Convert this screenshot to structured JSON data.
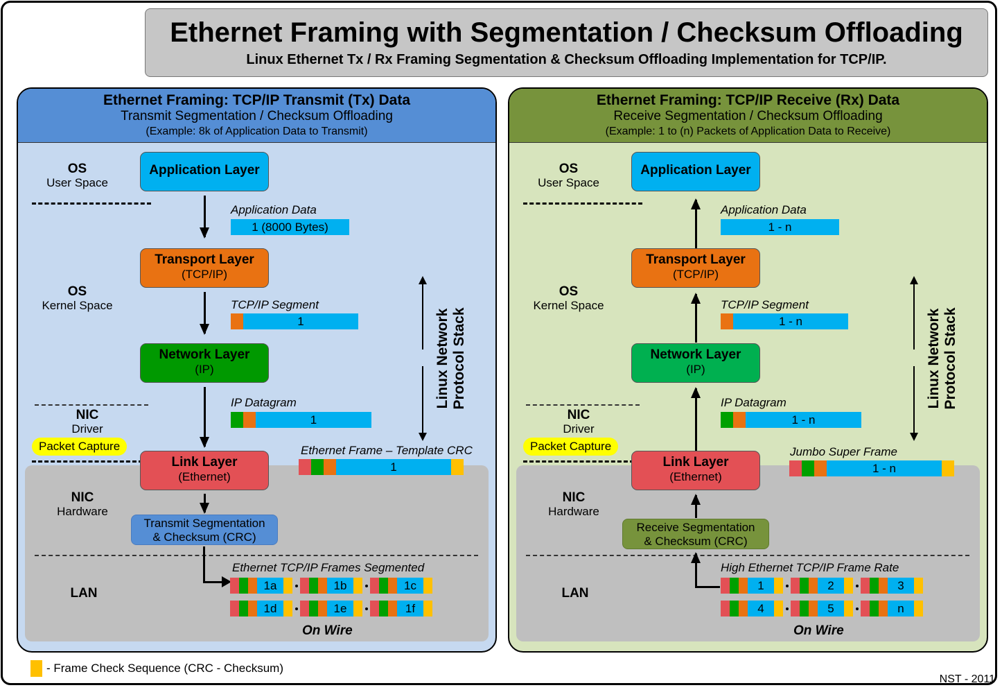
{
  "title": "Ethernet Framing with Segmentation / Checksum Offloading",
  "subtitle": "Linux Ethernet Tx / Rx Framing Segmentation & Checksum Offloading Implementation for TCP/IP.",
  "colors": {
    "tx_header": "#558ed5",
    "tx_body": "#c6d9f0",
    "rx_header": "#77933c",
    "rx_body": "#d7e4bd",
    "nic_area": "#bfbfbf",
    "application": "#00b0f0",
    "transport": "#e97212",
    "network_tx": "#009900",
    "network_rx": "#00b050",
    "link": "#e35055",
    "crc": "#ffc000",
    "capture": "#ffff00"
  },
  "tx": {
    "header": {
      "title": "Ethernet Framing: TCP/IP Transmit (Tx) Data",
      "subtitle": "Transmit Segmentation / Checksum Offloading",
      "example": "(Example: 8k of Application Data to Transmit)"
    },
    "side": {
      "os_user": {
        "title": "OS",
        "sub": "User Space"
      },
      "os_kernel": {
        "title": "OS",
        "sub": "Kernel Space"
      },
      "nic_driver": {
        "title": "NIC",
        "sub": "Driver"
      },
      "nic_hw": {
        "title": "NIC",
        "sub": "Hardware"
      },
      "lan": "LAN"
    },
    "packet_capture": "Packet Capture",
    "layers": {
      "application": {
        "name": "Application Layer"
      },
      "transport": {
        "name": "Transport Layer",
        "sub": "(TCP/IP)"
      },
      "network": {
        "name": "Network Layer",
        "sub": "(IP)"
      },
      "link": {
        "name": "Link Layer",
        "sub": "(Ethernet)"
      }
    },
    "hw_box": {
      "line1": "Transmit Segmentation",
      "line2": "& Checksum (CRC)"
    },
    "packets": {
      "app_data": {
        "label": "Application Data",
        "value": "1 (8000 Bytes)"
      },
      "segment": {
        "label": "TCP/IP Segment",
        "value": "1"
      },
      "datagram": {
        "label": "IP Datagram",
        "value": "1"
      },
      "frame": {
        "label": "Ethernet Frame – Template CRC",
        "value": "1"
      },
      "wire": {
        "label": "Ethernet TCP/IP Frames Segmented",
        "frames": [
          "1a",
          "1b",
          "1c",
          "1d",
          "1e",
          "1f"
        ]
      }
    },
    "stack_label": {
      "line1": "Linux Network",
      "line2": "Protocol Stack"
    },
    "on_wire": "On Wire"
  },
  "rx": {
    "header": {
      "title": "Ethernet Framing: TCP/IP Receive (Rx) Data",
      "subtitle": "Receive Segmentation / Checksum Offloading",
      "example": "(Example: 1 to (n) Packets of Application Data to Receive)"
    },
    "side": {
      "os_user": {
        "title": "OS",
        "sub": "User Space"
      },
      "os_kernel": {
        "title": "OS",
        "sub": "Kernel Space"
      },
      "nic_driver": {
        "title": "NIC",
        "sub": "Driver"
      },
      "nic_hw": {
        "title": "NIC",
        "sub": "Hardware"
      },
      "lan": "LAN"
    },
    "packet_capture": "Packet Capture",
    "layers": {
      "application": {
        "name": "Application Layer"
      },
      "transport": {
        "name": "Transport Layer",
        "sub": "(TCP/IP)"
      },
      "network": {
        "name": "Network Layer",
        "sub": "(IP)"
      },
      "link": {
        "name": "Link Layer",
        "sub": "(Ethernet)"
      }
    },
    "hw_box": {
      "line1": "Receive Segmentation",
      "line2": "& Checksum (CRC)"
    },
    "packets": {
      "app_data": {
        "label": "Application Data",
        "value": "1 - n"
      },
      "segment": {
        "label": "TCP/IP Segment",
        "value": "1 - n"
      },
      "datagram": {
        "label": "IP Datagram",
        "value": "1 - n"
      },
      "frame": {
        "label": "Jumbo Super Frame",
        "value": "1 - n"
      },
      "wire": {
        "label": "High Ethernet TCP/IP Frame Rate",
        "frames": [
          "1",
          "2",
          "3",
          "4",
          "5",
          "n"
        ]
      }
    },
    "stack_label": {
      "line1": "Linux Network",
      "line2": "Protocol Stack"
    },
    "on_wire": "On Wire"
  },
  "legend": {
    "crc": "- Frame Check Sequence (CRC - Checksum)"
  },
  "credit": "NST - 2011"
}
